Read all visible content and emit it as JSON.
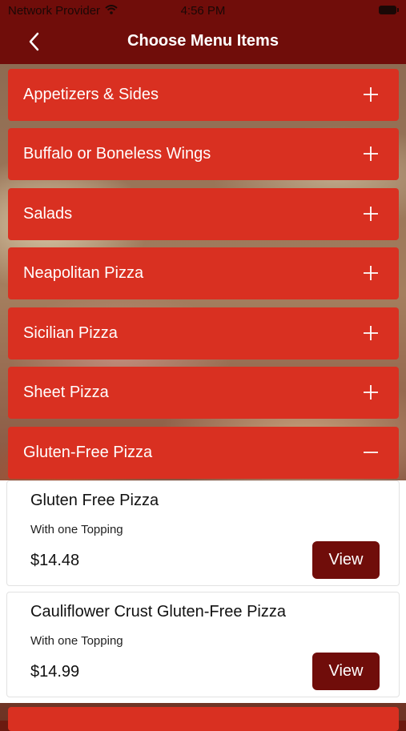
{
  "status": {
    "carrier": "Network Provider",
    "time": "4:56 PM"
  },
  "nav": {
    "title": "Choose Menu Items"
  },
  "categories": [
    {
      "label": "Appetizers & Sides",
      "state": "collapsed"
    },
    {
      "label": "Buffalo or Boneless Wings",
      "state": "collapsed"
    },
    {
      "label": "Salads",
      "state": "collapsed"
    },
    {
      "label": "Neapolitan Pizza",
      "state": "collapsed"
    },
    {
      "label": "Sicilian Pizza",
      "state": "collapsed"
    },
    {
      "label": "Sheet Pizza",
      "state": "collapsed"
    },
    {
      "label": "Gluten-Free Pizza",
      "state": "expanded"
    }
  ],
  "items": [
    {
      "name": "Gluten Free Pizza",
      "description": "With one Topping",
      "price": "$14.48",
      "button": "View"
    },
    {
      "name": "Cauliflower Crust Gluten-Free Pizza",
      "description": "With one Topping",
      "price": "$14.99",
      "button": "View"
    }
  ],
  "colors": {
    "nav": "#700d0a",
    "category": "#d93021",
    "button": "#700d0a"
  },
  "icons": {
    "back": "chevron-left-icon",
    "expand": "plus-icon",
    "collapse": "minus-icon"
  }
}
